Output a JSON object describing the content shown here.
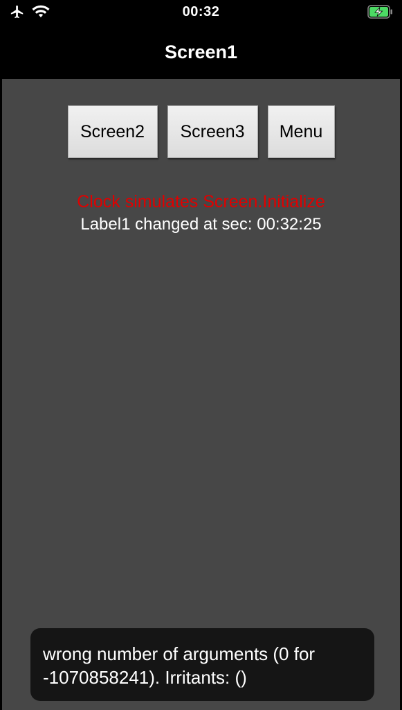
{
  "status_bar": {
    "time": "00:32",
    "left_icons": [
      "airplane-icon",
      "wifi-icon"
    ],
    "battery_icon": "battery-charging-icon",
    "battery_color": "#4cd964"
  },
  "nav": {
    "title": "Screen1"
  },
  "buttons": {
    "screen2": "Screen2",
    "screen3": "Screen3",
    "menu": "Menu"
  },
  "labels": {
    "clock": "Clock simulates Screen.Initialize",
    "clock_color": "#e00000",
    "label1": "Label1 changed at sec: 00:32:25"
  },
  "toast": {
    "message": "wrong number of arguments (0 for -1070858241). Irritants: ()"
  },
  "colors": {
    "background": "#474747",
    "bar": "#000000"
  }
}
